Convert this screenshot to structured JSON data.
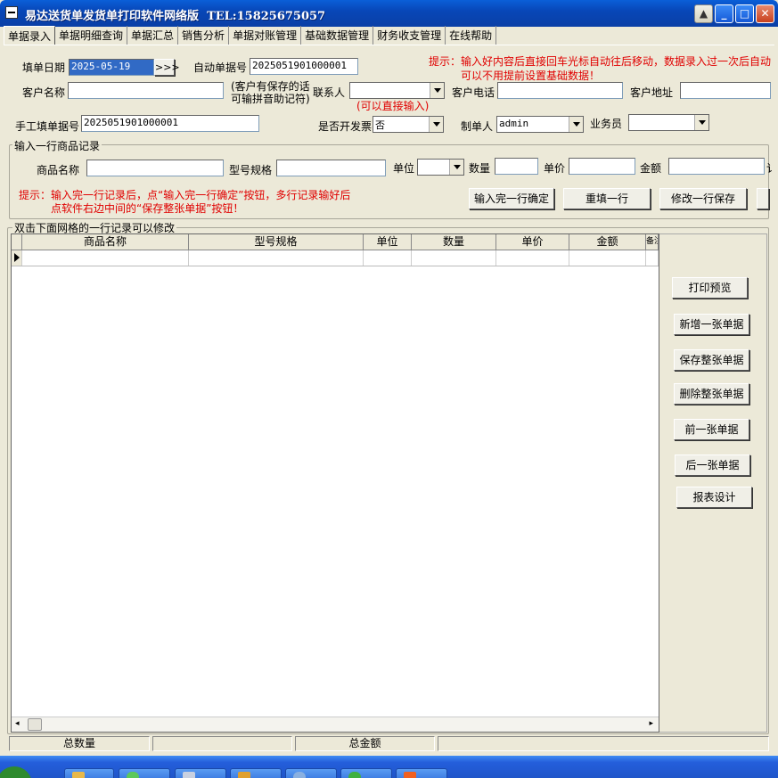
{
  "window": {
    "title": "易达送货单发货单打印软件网络版",
    "tel": "TEL:15825675057"
  },
  "tabs": [
    "单据录入",
    "单据明细查询",
    "单据汇总",
    "销售分析",
    "单据对账管理",
    "基础数据管理",
    "财务收支管理",
    "在线帮助"
  ],
  "header": {
    "date_label": "填单日期",
    "date_value": "2025-05-19",
    "date_button": ">>>",
    "auto_no_label": "自动单据号",
    "auto_no_value": "2025051901000001",
    "tip_line1": "提示：输入好内容后直接回车光标自动往后移动，数据录入过一次后自动",
    "tip_line2": "可以不用提前设置基础数据！",
    "customer_label": "客户名称",
    "customer_hint1": "(客户有保存的话",
    "customer_hint2": "可输拼音助记符)",
    "contact_label": "联系人",
    "contact_hint": "(可以直接输入)",
    "phone_label": "客户电话",
    "address_label": "客户地址",
    "manual_no_label": "手工填单据号",
    "manual_no_value": "2025051901000001",
    "invoice_label": "是否开发票",
    "invoice_value": "否",
    "maker_label": "制单人",
    "maker_value": "admin",
    "salesman_label": "业务员"
  },
  "entry": {
    "group_title": "输入一行商品记录",
    "product_label": "商品名称",
    "model_label": "型号规格",
    "unit_label": "单位",
    "qty_label": "数量",
    "price_label": "单价",
    "amount_label": "金额",
    "trailing_label": "讠",
    "tip_line1": "提示：输入完一行记录后，点“输入完一行确定”按钮，多行记录输好后",
    "tip_line2": "点软件右边中间的“保存整张单据”按钮！",
    "confirm_button": "输入完一行确定",
    "reset_button": "重填一行",
    "modify_button": "修改一行保存"
  },
  "grid": {
    "group_title": "双击下面网格的一行记录可以修改",
    "columns": [
      "商品名称",
      "型号规格",
      "单位",
      "数量",
      "单价",
      "金额",
      "备注"
    ]
  },
  "side_buttons": [
    "打印预览",
    "新增一张单据",
    "保存整张单据",
    "删除整张单据",
    "前一张单据",
    "后一张单据",
    "报表设计"
  ],
  "status": {
    "total_qty_label": "总数量",
    "total_amount_label": "总金额"
  },
  "colors": {
    "title_blue": "#0a4fc8",
    "tip_red": "#e00000",
    "taskbar_blue": "#245edb"
  }
}
